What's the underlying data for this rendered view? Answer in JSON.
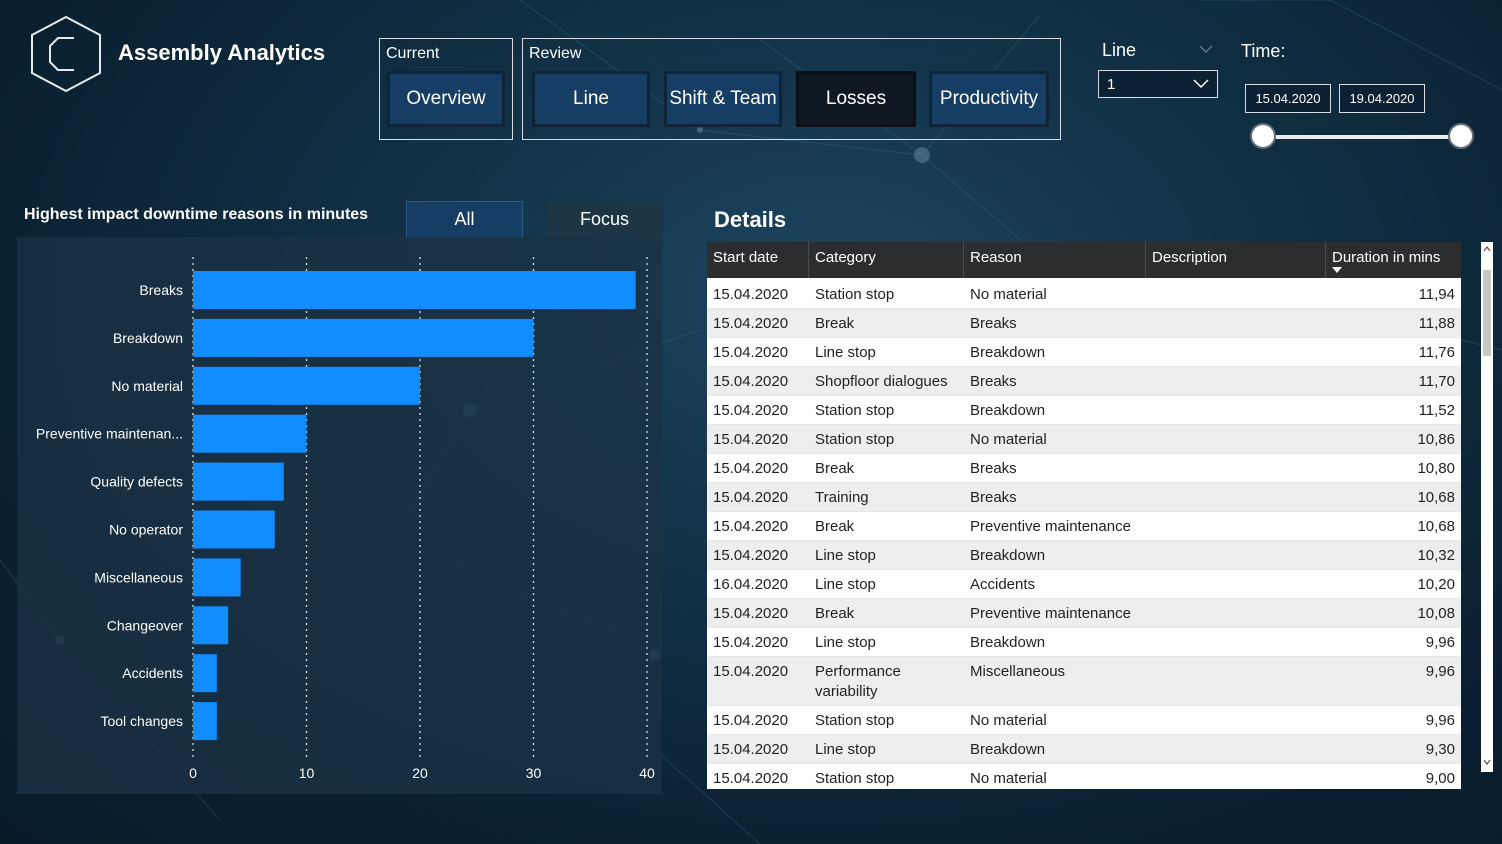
{
  "app": {
    "title": "Assembly Analytics"
  },
  "nav": {
    "current_label": "Current",
    "review_label": "Review",
    "overview": "Overview",
    "line": "Line",
    "shift_team": "Shift & Team",
    "losses": "Losses",
    "productivity": "Productivity",
    "active": "Losses"
  },
  "filters": {
    "line_label": "Line",
    "line_value": "1",
    "time_label": "Time:",
    "start_date": "15.04.2020",
    "end_date": "19.04.2020"
  },
  "chart_panel": {
    "title": "Highest impact downtime reasons in minutes",
    "toggle_all": "All",
    "toggle_focus": "Focus",
    "active_toggle": "All"
  },
  "chart_data": {
    "type": "bar",
    "orientation": "horizontal",
    "title": "Highest impact downtime reasons in minutes",
    "categories": [
      "Breaks",
      "Breakdown",
      "No material",
      "Preventive maintenan...",
      "Quality defects",
      "No operator",
      "Miscellaneous",
      "Changeover",
      "Accidents",
      "Tool changes"
    ],
    "values": [
      39,
      30,
      20,
      10,
      8,
      7.2,
      4.2,
      3.1,
      2.1,
      2.1
    ],
    "xlim": [
      0,
      40
    ],
    "xticks": [
      0,
      10,
      20,
      30,
      40
    ],
    "grid": true,
    "bar_color": "#118DFF"
  },
  "details": {
    "title": "Details",
    "columns": [
      "Start date",
      "Category",
      "Reason",
      "Description",
      "Duration in mins"
    ],
    "sorted_column": "Duration in mins",
    "rows": [
      [
        "15.04.2020",
        "Station stop",
        "No material",
        "",
        "11,94"
      ],
      [
        "15.04.2020",
        "Break",
        "Breaks",
        "",
        "11,88"
      ],
      [
        "15.04.2020",
        "Line stop",
        "Breakdown",
        "",
        "11,76"
      ],
      [
        "15.04.2020",
        "Shopfloor dialogues",
        "Breaks",
        "",
        "11,70"
      ],
      [
        "15.04.2020",
        "Station stop",
        "Breakdown",
        "",
        "11,52"
      ],
      [
        "15.04.2020",
        "Station stop",
        "No material",
        "",
        "10,86"
      ],
      [
        "15.04.2020",
        "Break",
        "Breaks",
        "",
        "10,80"
      ],
      [
        "15.04.2020",
        "Training",
        "Breaks",
        "",
        "10,68"
      ],
      [
        "15.04.2020",
        "Break",
        "Preventive maintenance",
        "",
        "10,68"
      ],
      [
        "15.04.2020",
        "Line stop",
        "Breakdown",
        "",
        "10,32"
      ],
      [
        "16.04.2020",
        "Line stop",
        "Accidents",
        "",
        "10,20"
      ],
      [
        "15.04.2020",
        "Break",
        "Preventive maintenance",
        "",
        "10,08"
      ],
      [
        "15.04.2020",
        "Line stop",
        "Breakdown",
        "",
        "9,96"
      ],
      [
        "15.04.2020",
        "Performance variability",
        "Miscellaneous",
        "",
        "9,96"
      ],
      [
        "15.04.2020",
        "Station stop",
        "No material",
        "",
        "9,96"
      ],
      [
        "15.04.2020",
        "Line stop",
        "Breakdown",
        "",
        "9,30"
      ],
      [
        "15.04.2020",
        "Station stop",
        "No material",
        "",
        "9,00"
      ]
    ]
  }
}
